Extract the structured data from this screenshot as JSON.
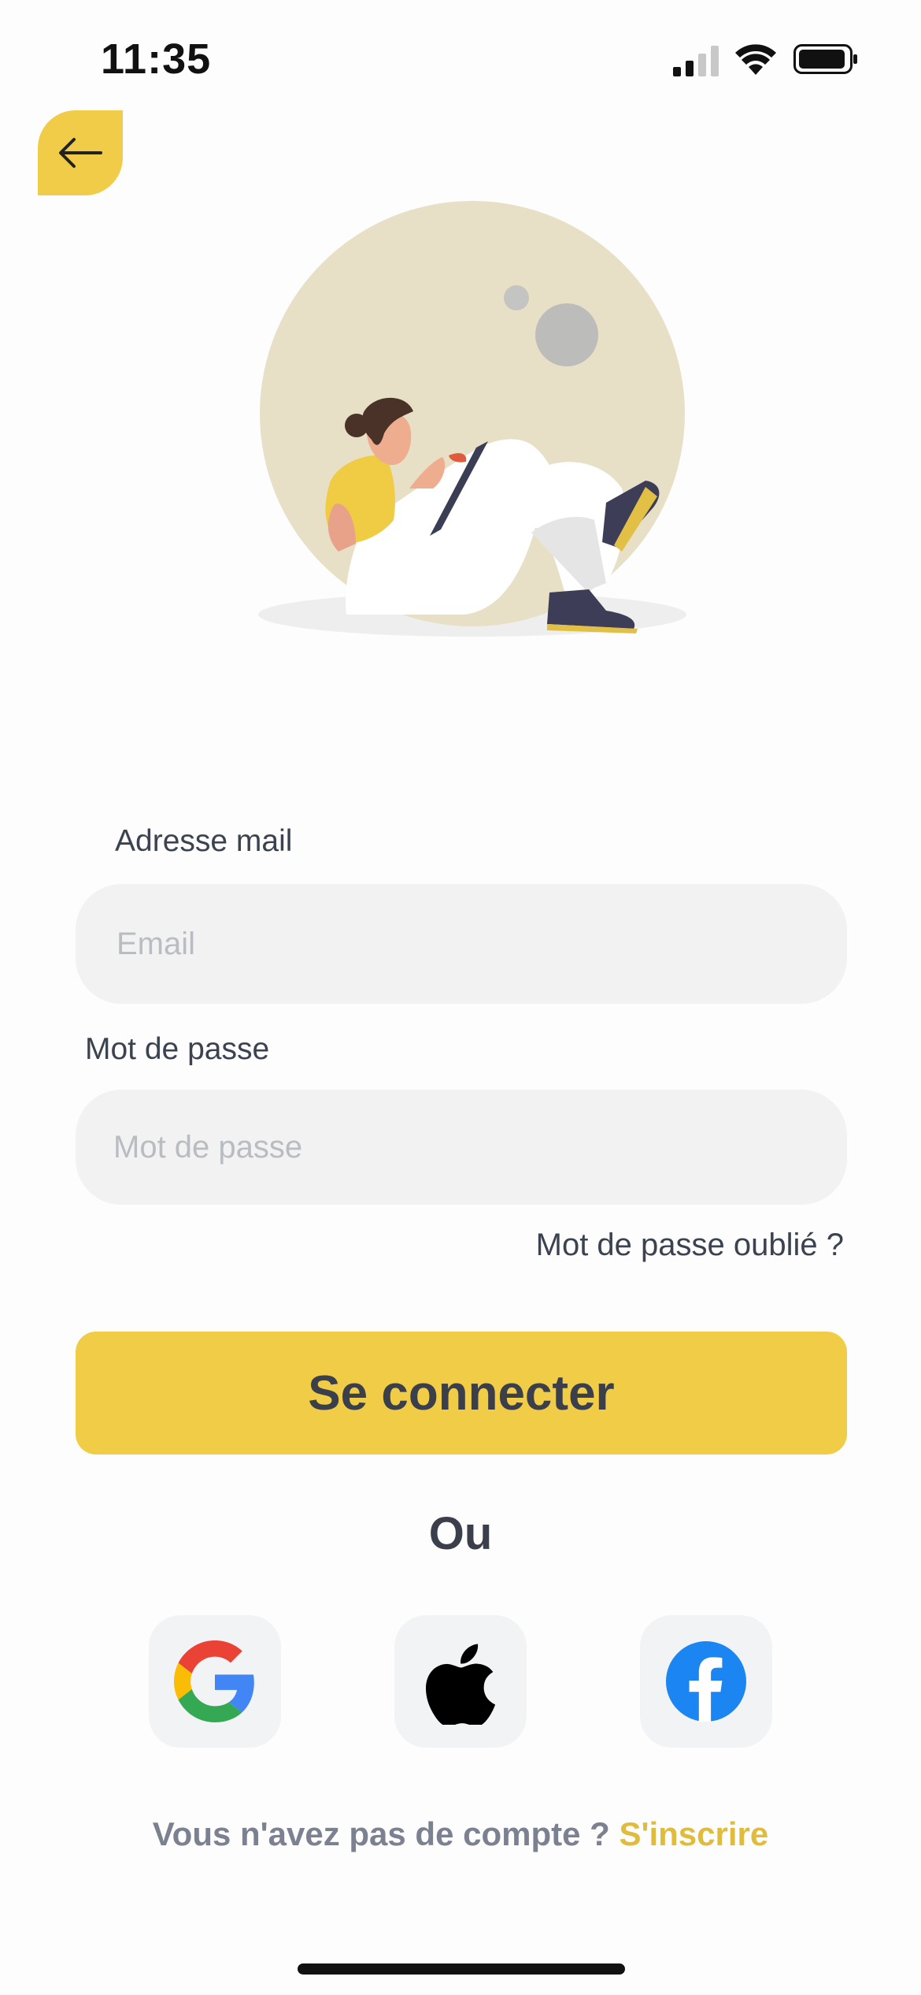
{
  "status_bar": {
    "time": "11:35"
  },
  "form": {
    "email_label": "Adresse mail",
    "email_placeholder": "Email",
    "password_label": "Mot de passe",
    "password_placeholder": "Mot de passe",
    "forgot_password": "Mot de passe oublié ?",
    "login_button": "Se connecter"
  },
  "social": {
    "or_text": "Ou",
    "providers": [
      "google-icon",
      "apple-icon",
      "facebook-icon"
    ]
  },
  "footer": {
    "prompt": "Vous n'avez pas de compte ? ",
    "signup_link": "S'inscrire"
  },
  "colors": {
    "accent": "#f0cc47",
    "link": "#e0bc3c",
    "input_background": "#f2f2f2",
    "social_background": "#f2f3f5",
    "text": "#3a3f4b"
  }
}
